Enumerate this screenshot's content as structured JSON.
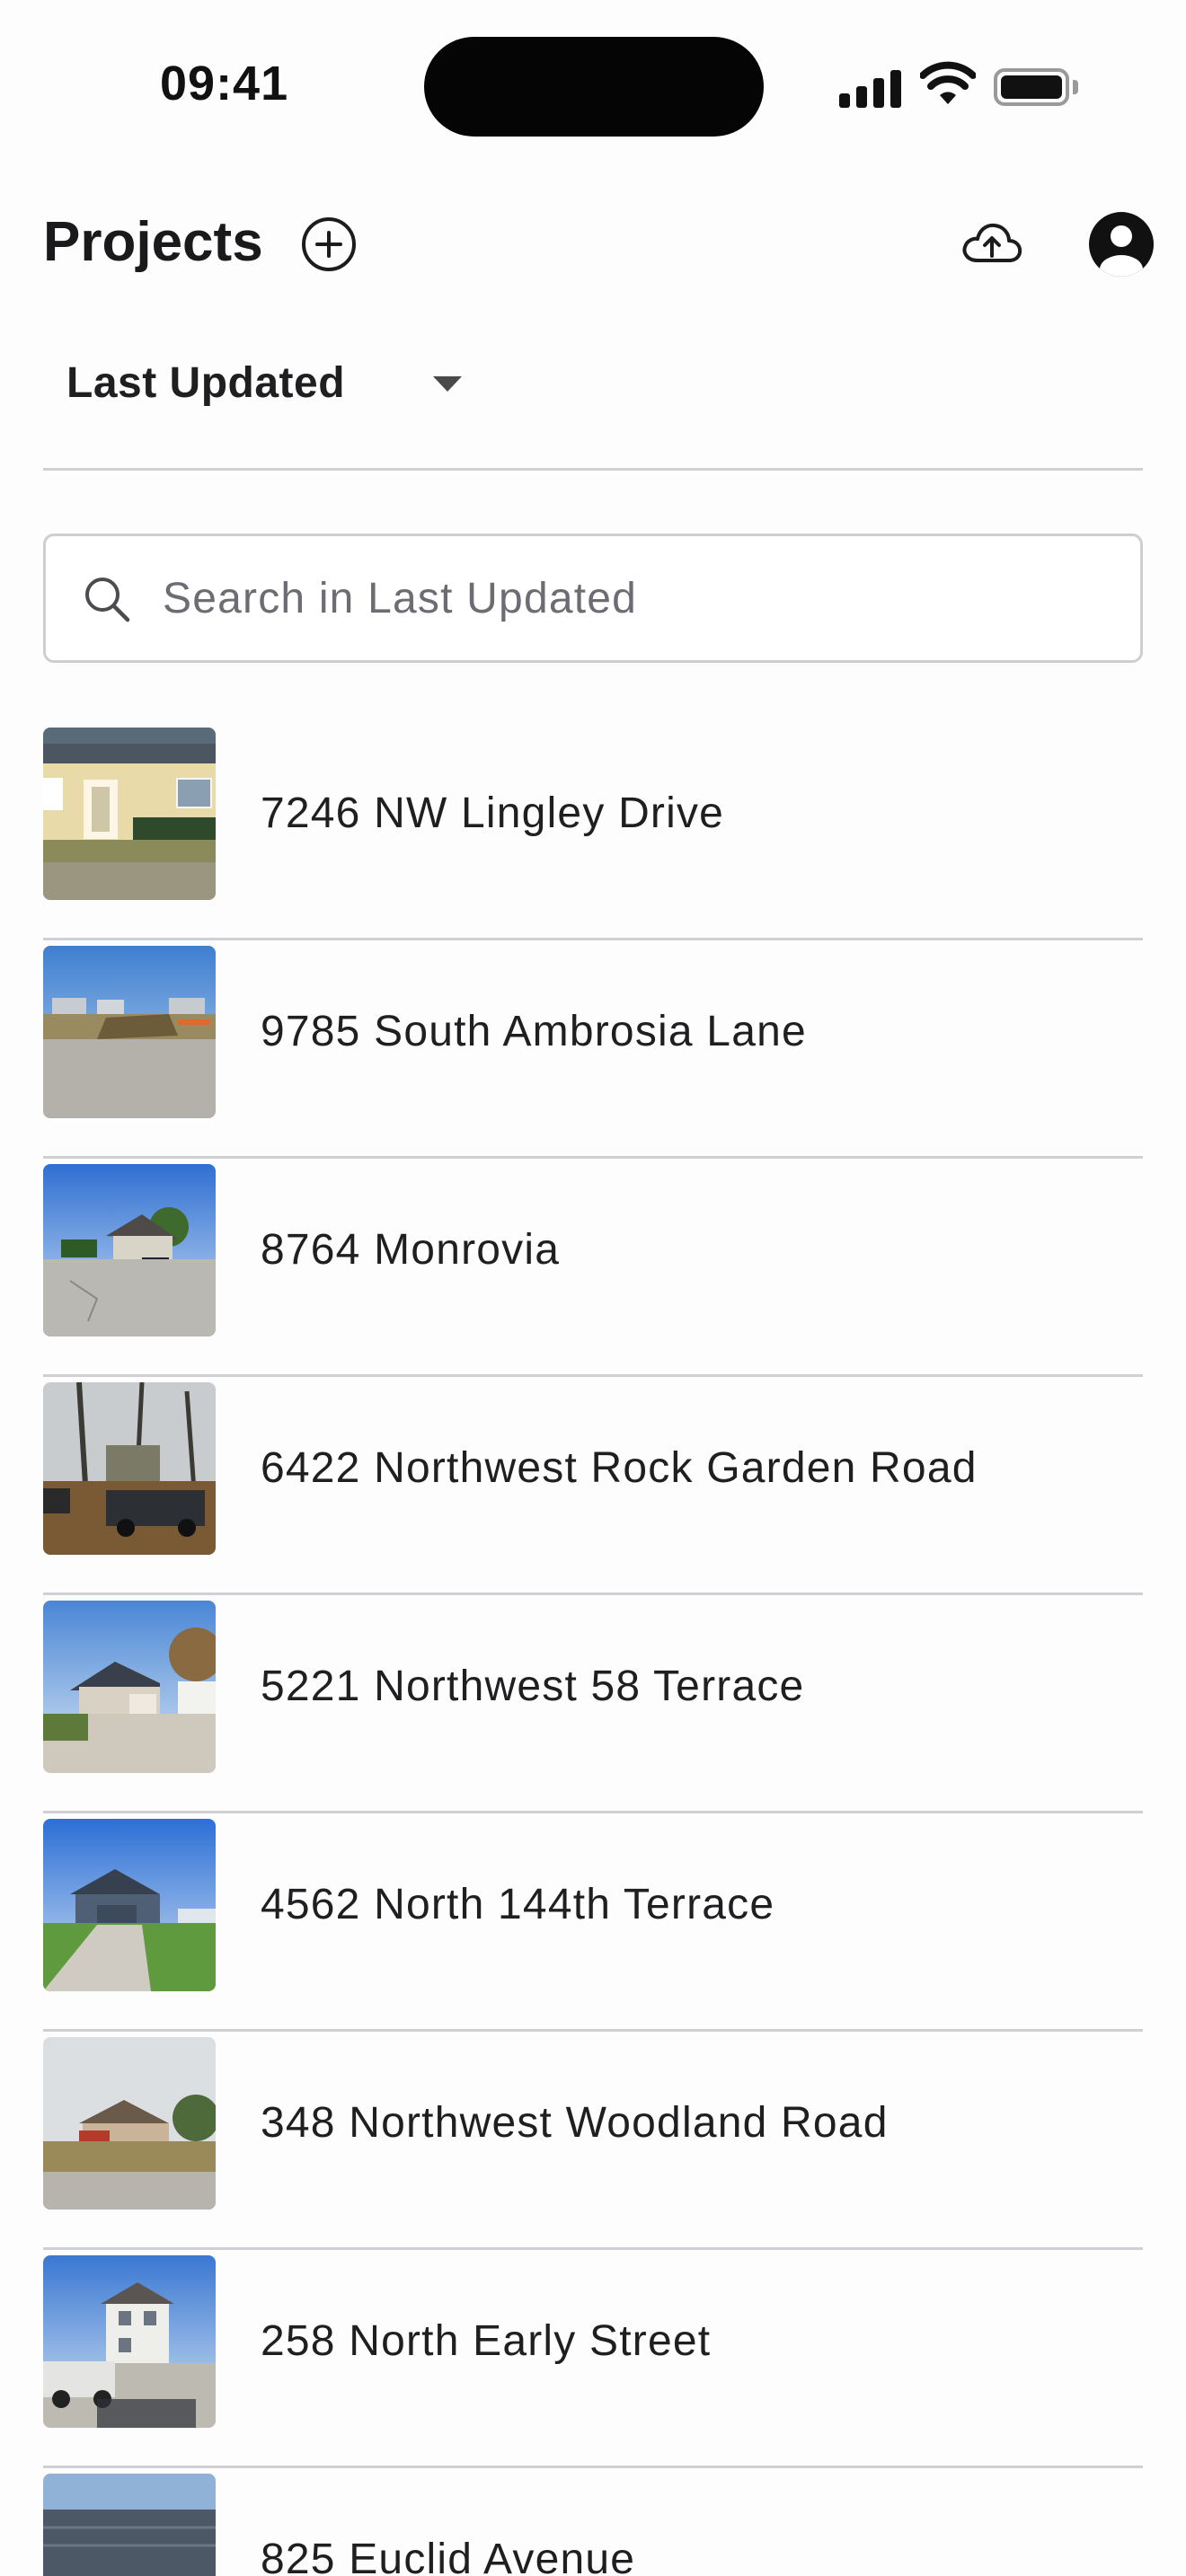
{
  "status_bar": {
    "time": "09:41"
  },
  "header": {
    "title": "Projects",
    "add_icon": "plus-circle-icon",
    "upload_icon": "cloud-upload-icon",
    "profile_icon": "account-circle-icon"
  },
  "sort": {
    "label": "Last Updated",
    "icon": "caret-down-icon"
  },
  "search": {
    "value": "",
    "placeholder": "Search in Last Updated",
    "icon": "search-icon"
  },
  "projects": [
    {
      "address": "7246 NW Lingley Drive"
    },
    {
      "address": "9785 South Ambrosia Lane"
    },
    {
      "address": "8764 Monrovia"
    },
    {
      "address": "6422 Northwest Rock Garden Road"
    },
    {
      "address": "5221 Northwest 58 Terrace"
    },
    {
      "address": "4562 North 144th Terrace"
    },
    {
      "address": "348 Northwest Woodland Road"
    },
    {
      "address": "258 North Early Street"
    },
    {
      "address": "825 Euclid Avenue"
    }
  ]
}
